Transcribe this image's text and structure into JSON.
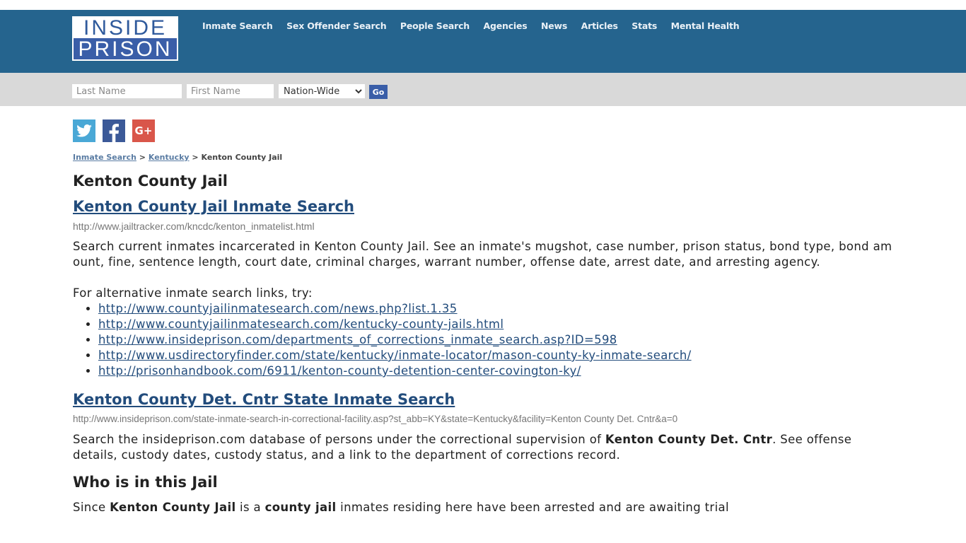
{
  "header": {
    "logo_top": "INSIDE",
    "logo_bottom": "PRISON",
    "nav": [
      {
        "label": "Inmate Search"
      },
      {
        "label": "Sex Offender Search"
      },
      {
        "label": "People Search"
      },
      {
        "label": "Agencies"
      },
      {
        "label": "News"
      },
      {
        "label": "Articles"
      },
      {
        "label": "Stats"
      },
      {
        "label": "Mental Health"
      }
    ],
    "colors": {
      "nav_bg": "#25648e",
      "logo_blue": "#3a5ea8"
    }
  },
  "search": {
    "last_name_placeholder": "Last Name",
    "last_name_value": "",
    "first_name_placeholder": "First Name",
    "first_name_value": "",
    "state_selected": "Nation-Wide",
    "go_label": "Go"
  },
  "social": {
    "twitter": "twitter-icon",
    "facebook": "facebook-icon",
    "googleplus_label": "G+"
  },
  "breadcrumb": {
    "items": [
      {
        "label": "Inmate Search",
        "link": true
      },
      {
        "label": "Kentucky",
        "link": true
      },
      {
        "label": "Kenton County Jail",
        "link": false
      }
    ],
    "separator": ">"
  },
  "main": {
    "title": "Kenton County Jail",
    "section1": {
      "heading": "Kenton County Jail Inmate Search",
      "url": "http://www.jailtracker.com/kncdc/kenton_inmatelist.html",
      "description": "Search current inmates incarcerated in Kenton County Jail. See an inmate's mugshot, case number, prison status, bond type, bond amount, fine, sentence length, court date, criminal charges, warrant number, offense date, arrest date, and arresting agency.",
      "alt_intro": "For alternative inmate search links, try:",
      "alt_links": [
        "http://www.countyjailinmatesearch.com/news.php?list.1.35",
        "http://www.countyjailinmatesearch.com/kentucky-county-jails.html",
        "http://www.insideprison.com/departments_of_corrections_inmate_search.asp?ID=598",
        "http://www.usdirectoryfinder.com/state/kentucky/inmate-locator/mason-county-ky-inmate-search/",
        "http://prisonhandbook.com/6911/kenton-county-detention-center-covington-ky/"
      ]
    },
    "section2": {
      "heading": "Kenton County Det. Cntr State Inmate Search",
      "url": "http://www.insideprison.com/state-inmate-search-in-correctional-facility.asp?st_abb=KY&state=Kentucky&facility=Kenton County Det. Cntr&a=0",
      "desc_before": "Search the insideprison.com database of persons under the correctional supervision of ",
      "desc_bold": "Kenton County Det. Cntr",
      "desc_after": ". See offense details, custody dates, custody status, and a link to the department of corrections record."
    },
    "section3": {
      "heading": "Who is in this Jail",
      "partial_before": "Since ",
      "partial_bold1": "Kenton County Jail",
      "partial_mid": " is a ",
      "partial_bold2": "county jail",
      "partial_after": " inmates residing here have been arrested and are awaiting trial"
    }
  }
}
